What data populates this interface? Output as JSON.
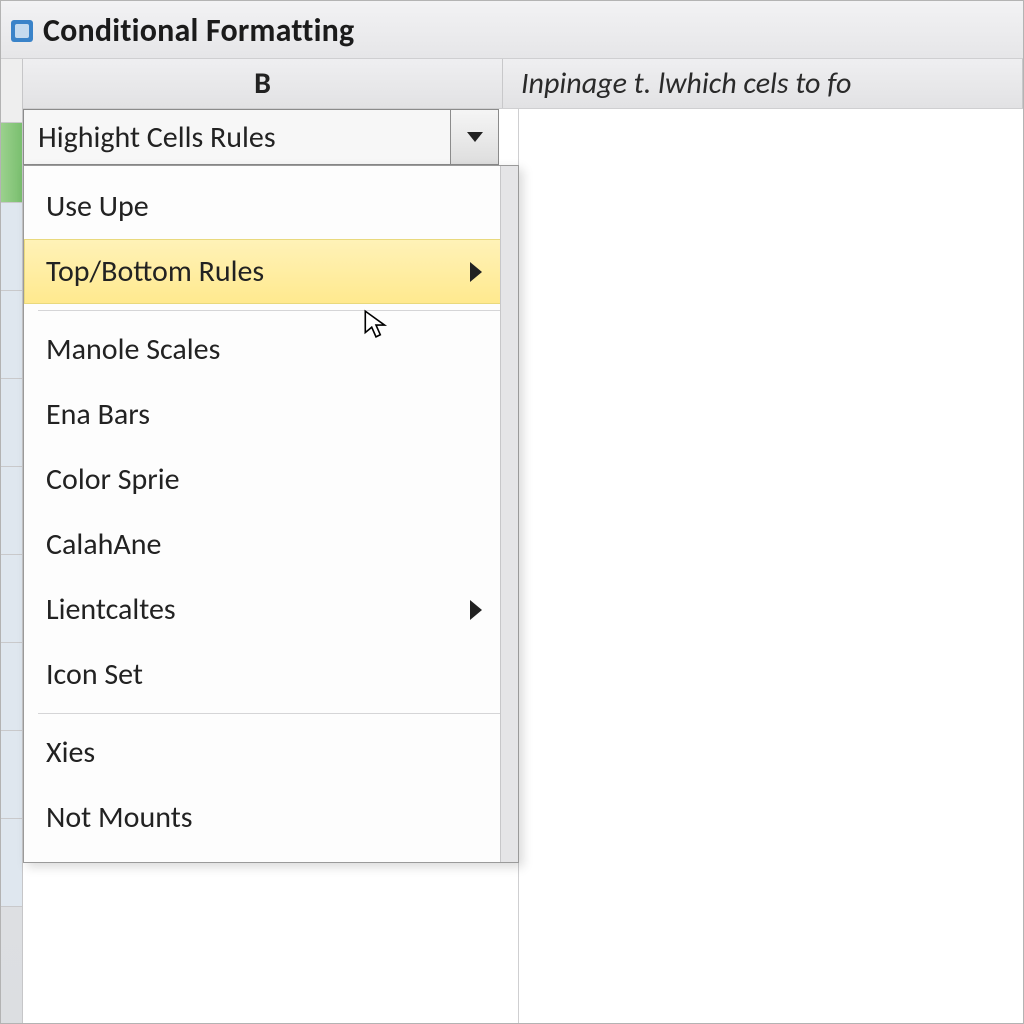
{
  "header": {
    "title": "Conditional Formatting"
  },
  "columns": {
    "b_label": "B",
    "hint_text": "Inpinage t. lwhich cels to fo"
  },
  "combo": {
    "selected": "Highight Cells Rules"
  },
  "menu": {
    "items": [
      {
        "label": "Use Upe",
        "has_submenu": false,
        "hover": false
      },
      {
        "label": "Top/Bottom Rules",
        "has_submenu": true,
        "hover": true
      },
      {
        "label": "Manole Scales",
        "has_submenu": false,
        "hover": false
      },
      {
        "label": "Ena Bars",
        "has_submenu": false,
        "hover": false
      },
      {
        "label": "Color Sprie",
        "has_submenu": false,
        "hover": false
      },
      {
        "label": "CalahAne",
        "has_submenu": false,
        "hover": false
      },
      {
        "label": "Lientcaltes",
        "has_submenu": true,
        "hover": false
      },
      {
        "label": "Icon Set",
        "has_submenu": false,
        "hover": false
      },
      {
        "label": "Xies",
        "has_submenu": false,
        "hover": false
      },
      {
        "label": "Not Mounts",
        "has_submenu": false,
        "hover": false
      }
    ],
    "separators_after": [
      1,
      7
    ]
  },
  "colors": {
    "highlight": "#ffe98e",
    "panel": "#e6e6e8"
  }
}
